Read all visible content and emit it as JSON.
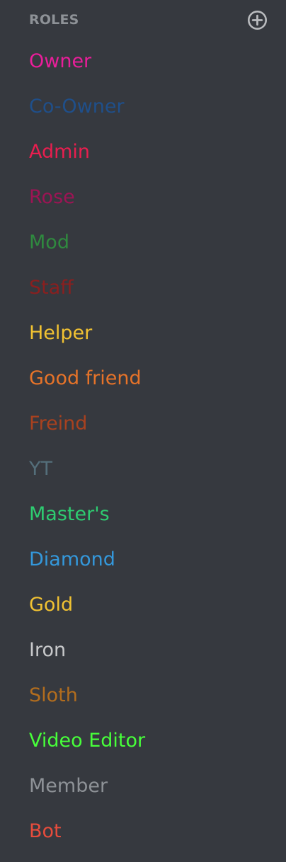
{
  "section": {
    "title": "ROLES",
    "add_icon": "plus-circle-icon",
    "title_color": "#8e9297",
    "background": "#36393f"
  },
  "roles": [
    {
      "label": "Owner",
      "color": "#e91e9a"
    },
    {
      "label": "Co-Owner",
      "color": "#1f4f8a"
    },
    {
      "label": "Admin",
      "color": "#e91e4f"
    },
    {
      "label": "Rose",
      "color": "#9c1454"
    },
    {
      "label": "Mod",
      "color": "#2f8a3f"
    },
    {
      "label": "Staff",
      "color": "#8a1f1f"
    },
    {
      "label": "Helper",
      "color": "#f1c232"
    },
    {
      "label": "Good friend",
      "color": "#e67329"
    },
    {
      "label": "Freind",
      "color": "#a8411f"
    },
    {
      "label": "YT",
      "color": "#546e7a"
    },
    {
      "label": "Master's",
      "color": "#2ecc71"
    },
    {
      "label": "Diamond",
      "color": "#3498db"
    },
    {
      "label": "Gold",
      "color": "#f1c232"
    },
    {
      "label": "Iron",
      "color": "#c8c9cb"
    },
    {
      "label": "Sloth",
      "color": "#b26d1e"
    },
    {
      "label": "Video Editor",
      "color": "#47ff3a"
    },
    {
      "label": "Member",
      "color": "#8e9297"
    },
    {
      "label": "Bot",
      "color": "#e74c3c"
    }
  ]
}
